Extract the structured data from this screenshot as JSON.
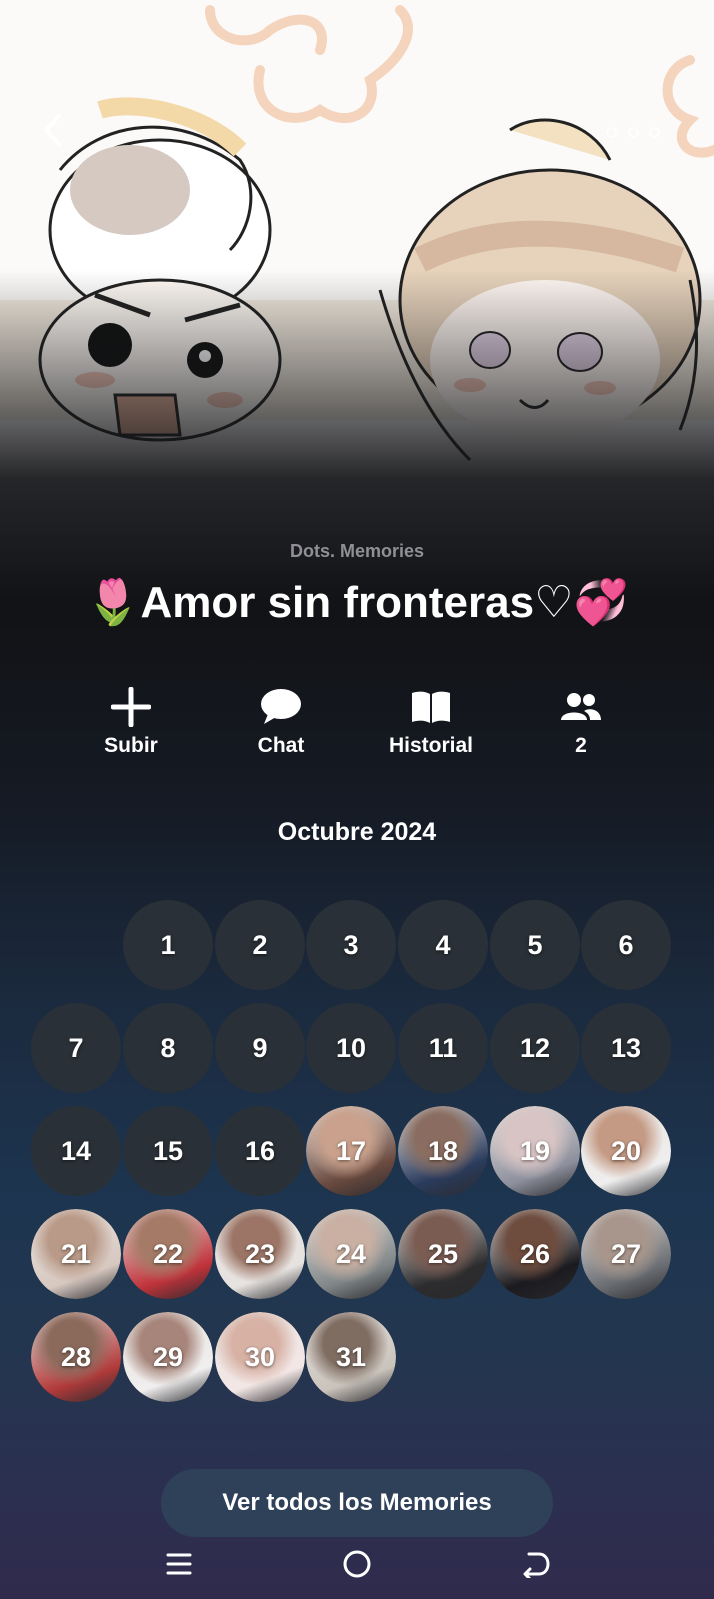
{
  "header": {
    "back_icon": "chevron-left-icon",
    "more_icon": "more-dots-icon"
  },
  "album": {
    "subtitle": "Dots. Memories",
    "title": "🌷Amor sin fronteras♡💞"
  },
  "actions": [
    {
      "label": "Subir",
      "icon": "plus-icon"
    },
    {
      "label": "Chat",
      "icon": "chat-bubble-icon"
    },
    {
      "label": "Historial",
      "icon": "book-icon"
    },
    {
      "label": "2",
      "icon": "people-icon"
    }
  ],
  "calendar": {
    "month_label": "Octubre 2024",
    "days": [
      "1",
      "2",
      "3",
      "4",
      "5",
      "6",
      "7",
      "8",
      "9",
      "10",
      "11",
      "12",
      "13",
      "14",
      "15",
      "16",
      "17",
      "18",
      "19",
      "20",
      "21",
      "22",
      "23",
      "24",
      "25",
      "26",
      "27",
      "28",
      "29",
      "30",
      "31"
    ],
    "days_with_photo": [
      "17",
      "18",
      "19",
      "20",
      "21",
      "22",
      "23",
      "24",
      "25",
      "26",
      "27",
      "28",
      "29",
      "30",
      "31"
    ]
  },
  "view_all_label": "Ver todos los Memories",
  "navbar": {
    "menu_icon": "menu-icon",
    "home_icon": "home-circle-icon",
    "back_icon": "back-arrow-icon"
  },
  "colors": {
    "day_empty": "#293037",
    "button_bg": "#2f4059",
    "text": "#ffffff",
    "subtitle": "#8f8f95"
  }
}
